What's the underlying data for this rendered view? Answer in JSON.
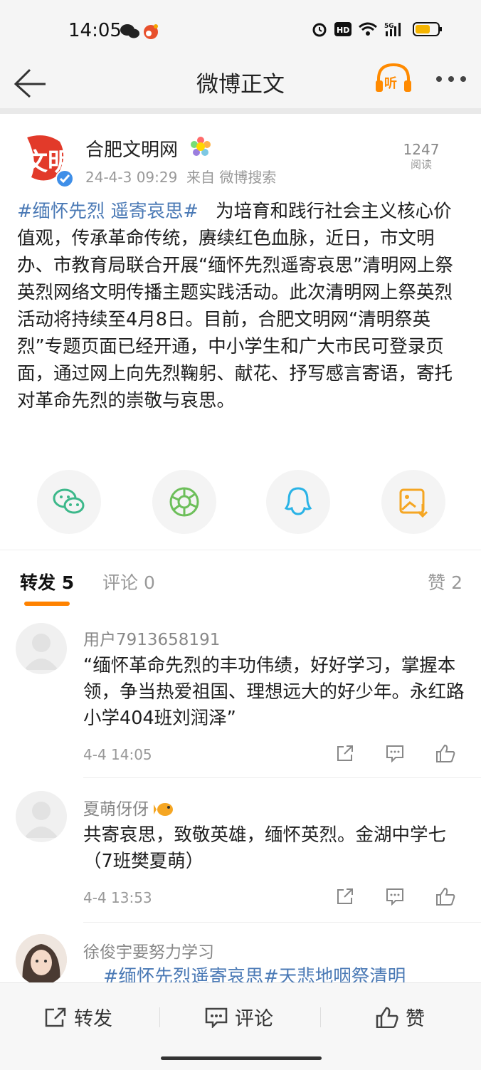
{
  "status_bar": {
    "time": "14:05",
    "battery_color": "#f5b400"
  },
  "nav": {
    "title": "微博正文",
    "listen_label": "听",
    "accent": "#ff8a00"
  },
  "post": {
    "author": "合肥文明网",
    "avatar_text": "文明",
    "timestamp": "24-4-3 09:29",
    "source": "来自 微博搜索",
    "read_count": "1247",
    "read_label": "阅读",
    "hashtag": "#缅怀先烈 遥寄哀思#",
    "body": "为培育和践行社会主义核心价值观，传承革命传统，赓续红色血脉，近日，市文明办、市教育局联合开展“缅怀先烈遥寄哀思”清明网上祭英烈网络文明传播主题实践活动。此次清明网上祭英烈活动将持续至4月8日。目前，合肥文明网“清明祭英烈”专题页面已经开通，中小学生和广大市民可登录页面，通过网上向先烈鞠躬、献花、抒写感言寄语，寄托对革命先烈的崇敬与哀思。",
    "share_targets": [
      "wechat-icon",
      "moments-icon",
      "qq-icon",
      "save-image-icon"
    ]
  },
  "tabs": {
    "repost": "转发 5",
    "comment": "评论 0",
    "like": "赞 2"
  },
  "reposts": [
    {
      "user": "用户7913658191",
      "text": "“缅怀革命先烈的丰功伟绩，好好学习，掌握本领，争当热爱祖国、理想远大的好少年。永红路小学404班刘润泽”",
      "time": "4-4 14:05"
    },
    {
      "user": "夏萌伢伢",
      "text": "共寄哀思，致敬英雄，缅怀英烈。金湖中学七（7班樊夏萌）",
      "time": "4-4 13:53"
    },
    {
      "user": "徐俊宇要努力学习",
      "text": "#缅怀先烈遥寄哀思#天悲地咽祭清明",
      "time": ""
    }
  ],
  "bottom_bar": {
    "repost": "转发",
    "comment": "评论",
    "like": "赞"
  }
}
